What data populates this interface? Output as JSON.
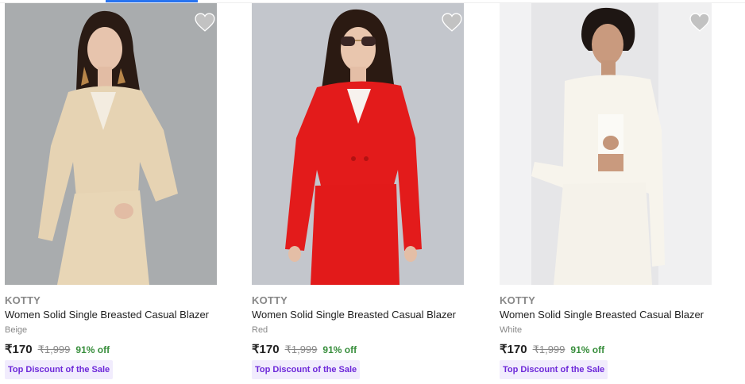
{
  "colors": {
    "accent": "#2874f0",
    "discount_green": "#388e3c",
    "badge_text": "#6d28d9",
    "badge_bg": "#f1ecfd",
    "wishlist_icon": "#c2c2c2"
  },
  "products": [
    {
      "brand": "KOTTY",
      "title": "Women Solid Single Breasted Casual Blazer",
      "color": "Beige",
      "price": "₹170",
      "mrp": "₹1,999",
      "discount": "91% off",
      "badge": "Top Discount of the Sale",
      "wishlist_icon": "heart-icon",
      "image": "woman-in-beige-blazer-photo"
    },
    {
      "brand": "KOTTY",
      "title": "Women Solid Single Breasted Casual Blazer",
      "color": "Red",
      "price": "₹170",
      "mrp": "₹1,999",
      "discount": "91% off",
      "badge": "Top Discount of the Sale",
      "wishlist_icon": "heart-icon",
      "image": "woman-in-red-blazer-photo"
    },
    {
      "brand": "KOTTY",
      "title": "Women Solid Single Breasted Casual Blazer",
      "color": "White",
      "price": "₹170",
      "mrp": "₹1,999",
      "discount": "91% off",
      "badge": "Top Discount of the Sale",
      "wishlist_icon": "heart-icon",
      "image": "woman-in-white-blazer-photo"
    }
  ]
}
